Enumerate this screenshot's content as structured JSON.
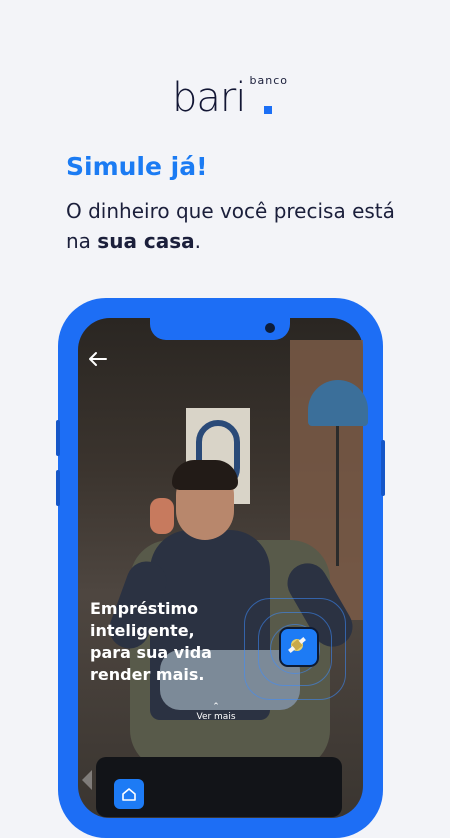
{
  "brand": {
    "small_label": "banco",
    "name": "bari",
    "accent_color": "#1b6ff5"
  },
  "hero": {
    "headline": "Simule já!",
    "subline_part1": "O dinheiro que você precisa está na ",
    "subline_bold": "sua casa",
    "subline_part2": "."
  },
  "phone_screen": {
    "back_icon": "arrow-left-icon",
    "promo_text": "Empréstimo\ninteligente,\npara sua vida\nrender mais.",
    "see_more_chevron": "chevron-up-icon",
    "see_more_label": "Ver mais",
    "app_icon": "coin-satellite-icon",
    "card_icon": "home-icon"
  }
}
